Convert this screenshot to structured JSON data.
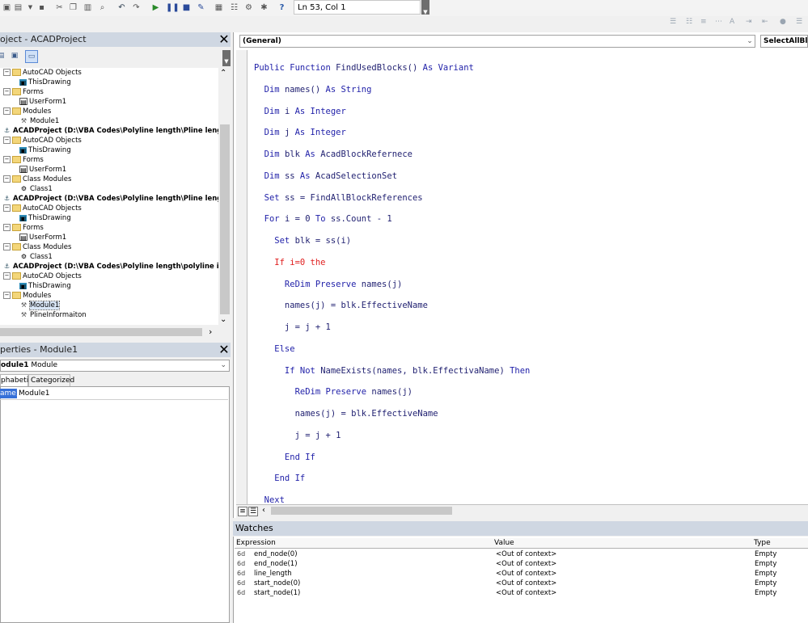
{
  "toolbar": {
    "cursor_position": "Ln 53, Col 1"
  },
  "project_explorer": {
    "title": "oject - ACADProject",
    "close_symbol": "✕",
    "tree": [
      {
        "label": "AutoCAD Objects",
        "type": "folder",
        "indent": 1,
        "expander": "−",
        "bold": false
      },
      {
        "label": "ThisDrawing",
        "type": "drawing",
        "indent": 2,
        "expander": "",
        "bold": false
      },
      {
        "label": "Forms",
        "type": "folder",
        "indent": 1,
        "expander": "−",
        "bold": false
      },
      {
        "label": "UserForm1",
        "type": "form",
        "indent": 2,
        "expander": "",
        "bold": false
      },
      {
        "label": "Modules",
        "type": "folder",
        "indent": 1,
        "expander": "−",
        "bold": false
      },
      {
        "label": "Module1",
        "type": "module",
        "indent": 2,
        "expander": "",
        "bold": false
      },
      {
        "label": "ACADProject (D:\\VBA Codes\\Polyline length\\Pline lengt...)",
        "type": "project",
        "indent": 0,
        "expander": "",
        "bold": true
      },
      {
        "label": "AutoCAD Objects",
        "type": "folder",
        "indent": 1,
        "expander": "−",
        "bold": false
      },
      {
        "label": "ThisDrawing",
        "type": "drawing",
        "indent": 2,
        "expander": "",
        "bold": false
      },
      {
        "label": "Forms",
        "type": "folder",
        "indent": 1,
        "expander": "−",
        "bold": false
      },
      {
        "label": "UserForm1",
        "type": "form",
        "indent": 2,
        "expander": "",
        "bold": false
      },
      {
        "label": "Class Modules",
        "type": "folder",
        "indent": 1,
        "expander": "−",
        "bold": false
      },
      {
        "label": "Class1",
        "type": "class",
        "indent": 2,
        "expander": "",
        "bold": false
      },
      {
        "label": "ACADProject (D:\\VBA Codes\\Polyline length\\Pline lengt...)",
        "type": "project",
        "indent": 0,
        "expander": "",
        "bold": true
      },
      {
        "label": "AutoCAD Objects",
        "type": "folder",
        "indent": 1,
        "expander": "−",
        "bold": false
      },
      {
        "label": "ThisDrawing",
        "type": "drawing",
        "indent": 2,
        "expander": "",
        "bold": false
      },
      {
        "label": "Forms",
        "type": "folder",
        "indent": 1,
        "expander": "−",
        "bold": false
      },
      {
        "label": "UserForm1",
        "type": "form",
        "indent": 2,
        "expander": "",
        "bold": false
      },
      {
        "label": "Class Modules",
        "type": "folder",
        "indent": 1,
        "expander": "−",
        "bold": false
      },
      {
        "label": "Class1",
        "type": "class",
        "indent": 2,
        "expander": "",
        "bold": false
      },
      {
        "label": "ACADProject (D:\\VBA Codes\\Polyline length\\polyline in...)",
        "type": "project",
        "indent": 0,
        "expander": "",
        "bold": true
      },
      {
        "label": "AutoCAD Objects",
        "type": "folder",
        "indent": 1,
        "expander": "−",
        "bold": false
      },
      {
        "label": "ThisDrawing",
        "type": "drawing",
        "indent": 2,
        "expander": "",
        "bold": false
      },
      {
        "label": "Modules",
        "type": "folder",
        "indent": 1,
        "expander": "−",
        "bold": false
      },
      {
        "label": "Module1",
        "type": "module",
        "indent": 2,
        "expander": "",
        "bold": false
      },
      {
        "label": "PlineInformaiton",
        "type": "module",
        "indent": 2,
        "expander": "",
        "bold": false
      }
    ]
  },
  "properties": {
    "title": "perties - Module1",
    "close_symbol": "✕",
    "object_name": "odule1",
    "object_type": "Module",
    "tab_alphabetic": "phabetic",
    "tab_categorized": "Categorized",
    "name_key": "ame)",
    "name_value": "Module1"
  },
  "code_window": {
    "object_combo": "(General)",
    "procedure_combo": "SelectAllBloc",
    "lines": [
      [
        {
          "t": "Public Function ",
          "c": "kw"
        },
        {
          "t": "FindUsedBlocks() ",
          "c": ""
        },
        {
          "t": "As Variant",
          "c": "kw"
        }
      ],
      [
        {
          "t": "  Dim ",
          "c": "kw"
        },
        {
          "t": "names() ",
          "c": ""
        },
        {
          "t": "As String",
          "c": "kw"
        }
      ],
      [
        {
          "t": "  Dim ",
          "c": "kw"
        },
        {
          "t": "i ",
          "c": ""
        },
        {
          "t": "As Integer",
          "c": "kw"
        }
      ],
      [
        {
          "t": "  Dim ",
          "c": "kw"
        },
        {
          "t": "j ",
          "c": ""
        },
        {
          "t": "As Integer",
          "c": "kw"
        }
      ],
      [
        {
          "t": "  Dim ",
          "c": "kw"
        },
        {
          "t": "blk ",
          "c": ""
        },
        {
          "t": "As ",
          "c": "kw"
        },
        {
          "t": "AcadBlockRefernece",
          "c": ""
        }
      ],
      [
        {
          "t": "  Dim ",
          "c": "kw"
        },
        {
          "t": "ss ",
          "c": ""
        },
        {
          "t": "As ",
          "c": "kw"
        },
        {
          "t": "AcadSelectionSet",
          "c": ""
        }
      ],
      [
        {
          "t": "  Set ",
          "c": "kw"
        },
        {
          "t": "ss = FindAllBlockReferences",
          "c": ""
        }
      ],
      [
        {
          "t": "  For ",
          "c": "kw"
        },
        {
          "t": "i = 0 ",
          "c": ""
        },
        {
          "t": "To ",
          "c": "kw"
        },
        {
          "t": "ss.Count - 1",
          "c": ""
        }
      ],
      [
        {
          "t": "    Set ",
          "c": "kw"
        },
        {
          "t": "blk = ss(i)",
          "c": ""
        }
      ],
      [
        {
          "t": "    If i=0 the",
          "c": "err"
        }
      ],
      [
        {
          "t": "      ReDim Preserve ",
          "c": "kw"
        },
        {
          "t": "names(j)",
          "c": ""
        }
      ],
      [
        {
          "t": "      names(j) = blk.EffectiveName",
          "c": ""
        }
      ],
      [
        {
          "t": "      j = j + 1",
          "c": ""
        }
      ],
      [
        {
          "t": "    Else",
          "c": "kw"
        }
      ],
      [
        {
          "t": "      If Not ",
          "c": "kw"
        },
        {
          "t": "NameExists(names, blk.EffectivaName) ",
          "c": ""
        },
        {
          "t": "Then",
          "c": "kw"
        }
      ],
      [
        {
          "t": "        ReDim Preserve ",
          "c": "kw"
        },
        {
          "t": "names(j)",
          "c": ""
        }
      ],
      [
        {
          "t": "        names(j) = blk.EffectiveName",
          "c": ""
        }
      ],
      [
        {
          "t": "        j = j + 1",
          "c": ""
        }
      ],
      [
        {
          "t": "      End If",
          "c": "kw"
        }
      ],
      [
        {
          "t": "    End If",
          "c": "kw"
        }
      ],
      [
        {
          "t": "  Next",
          "c": "kw"
        }
      ]
    ]
  },
  "watches": {
    "title": "Watches",
    "headers": {
      "expression": "Expression",
      "value": "Value",
      "type": "Type"
    },
    "rows": [
      {
        "icon": "6d",
        "expression": "end_node(0)",
        "value": "<Out of context>",
        "type": "Empty"
      },
      {
        "icon": "6d",
        "expression": "end_node(1)",
        "value": "<Out of context>",
        "type": "Empty"
      },
      {
        "icon": "6d",
        "expression": "line_length",
        "value": "<Out of context>",
        "type": "Empty"
      },
      {
        "icon": "6d",
        "expression": "start_node(0)",
        "value": "<Out of context>",
        "type": "Empty"
      },
      {
        "icon": "6d",
        "expression": "start_node(1)",
        "value": "<Out of context>",
        "type": "Empty"
      }
    ]
  },
  "colors": {
    "keyword": "#1f1fa8",
    "error": "#e02020",
    "panel_title": "#cfd7e2",
    "selection": "#3670d8"
  }
}
